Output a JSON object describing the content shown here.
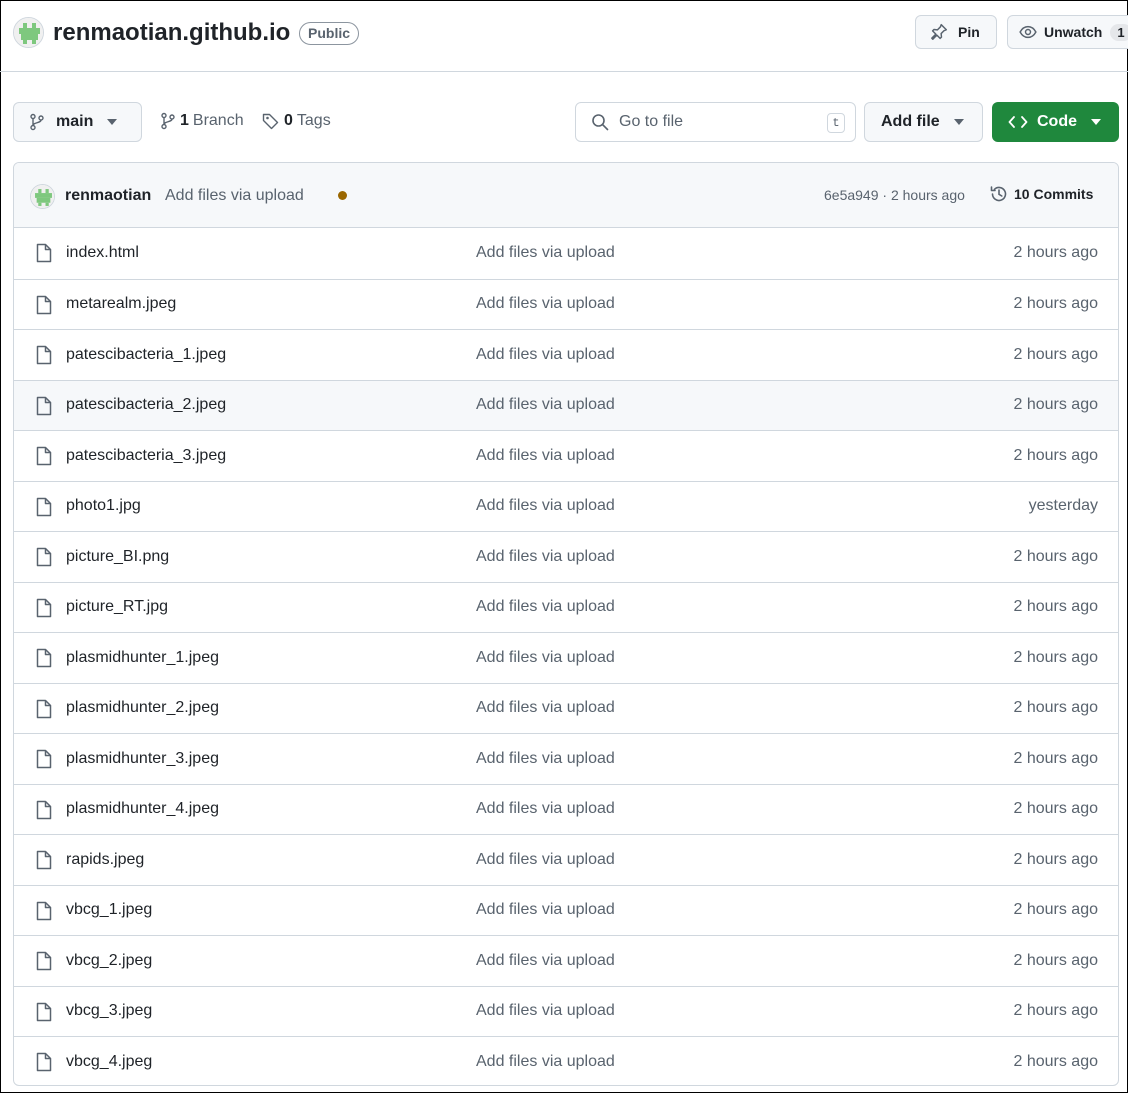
{
  "repo": {
    "name": "renmaotian.github.io",
    "visibility": "Public",
    "pin_label": "Pin",
    "unwatch_label": "Unwatch",
    "watch_count": "1"
  },
  "toolbar": {
    "branch": "main",
    "branches_count": "1",
    "branches_label": "Branch",
    "tags_count": "0",
    "tags_label": "Tags",
    "search_placeholder": "Go to file",
    "search_shortcut": "t",
    "add_file_label": "Add file",
    "code_label": "Code"
  },
  "latest_commit": {
    "author": "renmaotian",
    "message": "Add files via upload",
    "meta": "6e5a949 · 2 hours ago",
    "commits_label": "10 Commits",
    "status_color": "#9a6700"
  },
  "colors": {
    "accent_green": "#1f883d",
    "muted_text": "#59636e",
    "border": "#d0d7de"
  },
  "files": [
    {
      "name": "index.html",
      "message": "Add files via upload",
      "time": "2 hours ago"
    },
    {
      "name": "metarealm.jpeg",
      "message": "Add files via upload",
      "time": "2 hours ago"
    },
    {
      "name": "patescibacteria_1.jpeg",
      "message": "Add files via upload",
      "time": "2 hours ago"
    },
    {
      "name": "patescibacteria_2.jpeg",
      "message": "Add files via upload",
      "time": "2 hours ago"
    },
    {
      "name": "patescibacteria_3.jpeg",
      "message": "Add files via upload",
      "time": "2 hours ago"
    },
    {
      "name": "photo1.jpg",
      "message": "Add files via upload",
      "time": "yesterday"
    },
    {
      "name": "picture_BI.png",
      "message": "Add files via upload",
      "time": "2 hours ago"
    },
    {
      "name": "picture_RT.jpg",
      "message": "Add files via upload",
      "time": "2 hours ago"
    },
    {
      "name": "plasmidhunter_1.jpeg",
      "message": "Add files via upload",
      "time": "2 hours ago"
    },
    {
      "name": "plasmidhunter_2.jpeg",
      "message": "Add files via upload",
      "time": "2 hours ago"
    },
    {
      "name": "plasmidhunter_3.jpeg",
      "message": "Add files via upload",
      "time": "2 hours ago"
    },
    {
      "name": "plasmidhunter_4.jpeg",
      "message": "Add files via upload",
      "time": "2 hours ago"
    },
    {
      "name": "rapids.jpeg",
      "message": "Add files via upload",
      "time": "2 hours ago"
    },
    {
      "name": "vbcg_1.jpeg",
      "message": "Add files via upload",
      "time": "2 hours ago"
    },
    {
      "name": "vbcg_2.jpeg",
      "message": "Add files via upload",
      "time": "2 hours ago"
    },
    {
      "name": "vbcg_3.jpeg",
      "message": "Add files via upload",
      "time": "2 hours ago"
    },
    {
      "name": "vbcg_4.jpeg",
      "message": "Add files via upload",
      "time": "2 hours ago"
    }
  ],
  "icons": {
    "avatar": "identicon-avatar",
    "pin": "pin-icon",
    "eye": "eye-icon",
    "branch": "git-branch-icon",
    "tag": "tag-icon",
    "search": "search-icon",
    "code": "code-icon",
    "history": "history-icon",
    "file": "file-icon"
  }
}
